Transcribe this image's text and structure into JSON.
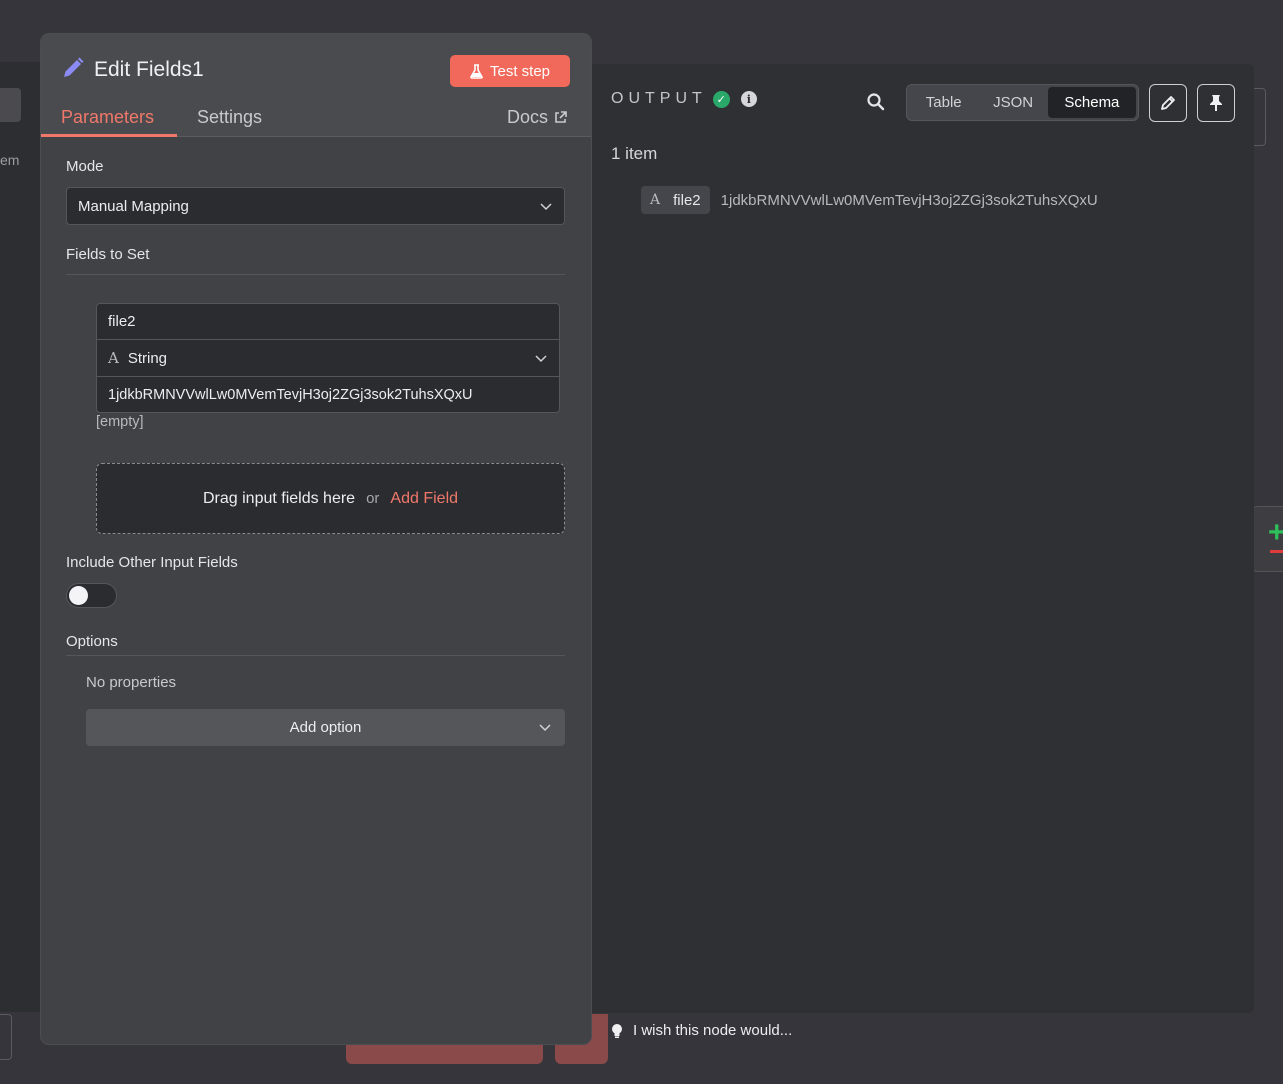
{
  "background": {
    "left_text": "em"
  },
  "output": {
    "title": "OUTPUT",
    "views": [
      "Table",
      "JSON",
      "Schema"
    ],
    "active_view": "Schema",
    "item_count": "1 item",
    "schema": [
      {
        "type_glyph": "A",
        "key": "file2",
        "value": "1jdkbRMNVVwlLw0MVemTevjH3oj2ZGj3sok2TuhsXQxU"
      }
    ]
  },
  "panel": {
    "title": "Edit Fields1",
    "test_step_label": "Test step",
    "tabs": [
      "Parameters",
      "Settings"
    ],
    "active_tab": "Parameters",
    "docs_label": "Docs",
    "mode_label": "Mode",
    "mode_value": "Manual Mapping",
    "fields_label": "Fields to Set",
    "field": {
      "name": "file2",
      "type_glyph": "A",
      "type": "String",
      "value": "1jdkbRMNVVwlLw0MVemTevjH3oj2ZGj3sok2TuhsXQxU",
      "hint": "[empty]"
    },
    "drop_zone": {
      "drag_text": "Drag input fields here",
      "or_text": "or",
      "add_field": "Add Field"
    },
    "include_label": "Include Other Input Fields",
    "include_enabled": false,
    "options_label": "Options",
    "no_properties": "No properties",
    "add_option": "Add option"
  },
  "footer": {
    "wish_text": "I wish this node would..."
  },
  "colors": {
    "accent": "#f0786a",
    "test_button": "#f0695b",
    "success": "#2aa86a",
    "pencil": "#8b8bf5"
  }
}
